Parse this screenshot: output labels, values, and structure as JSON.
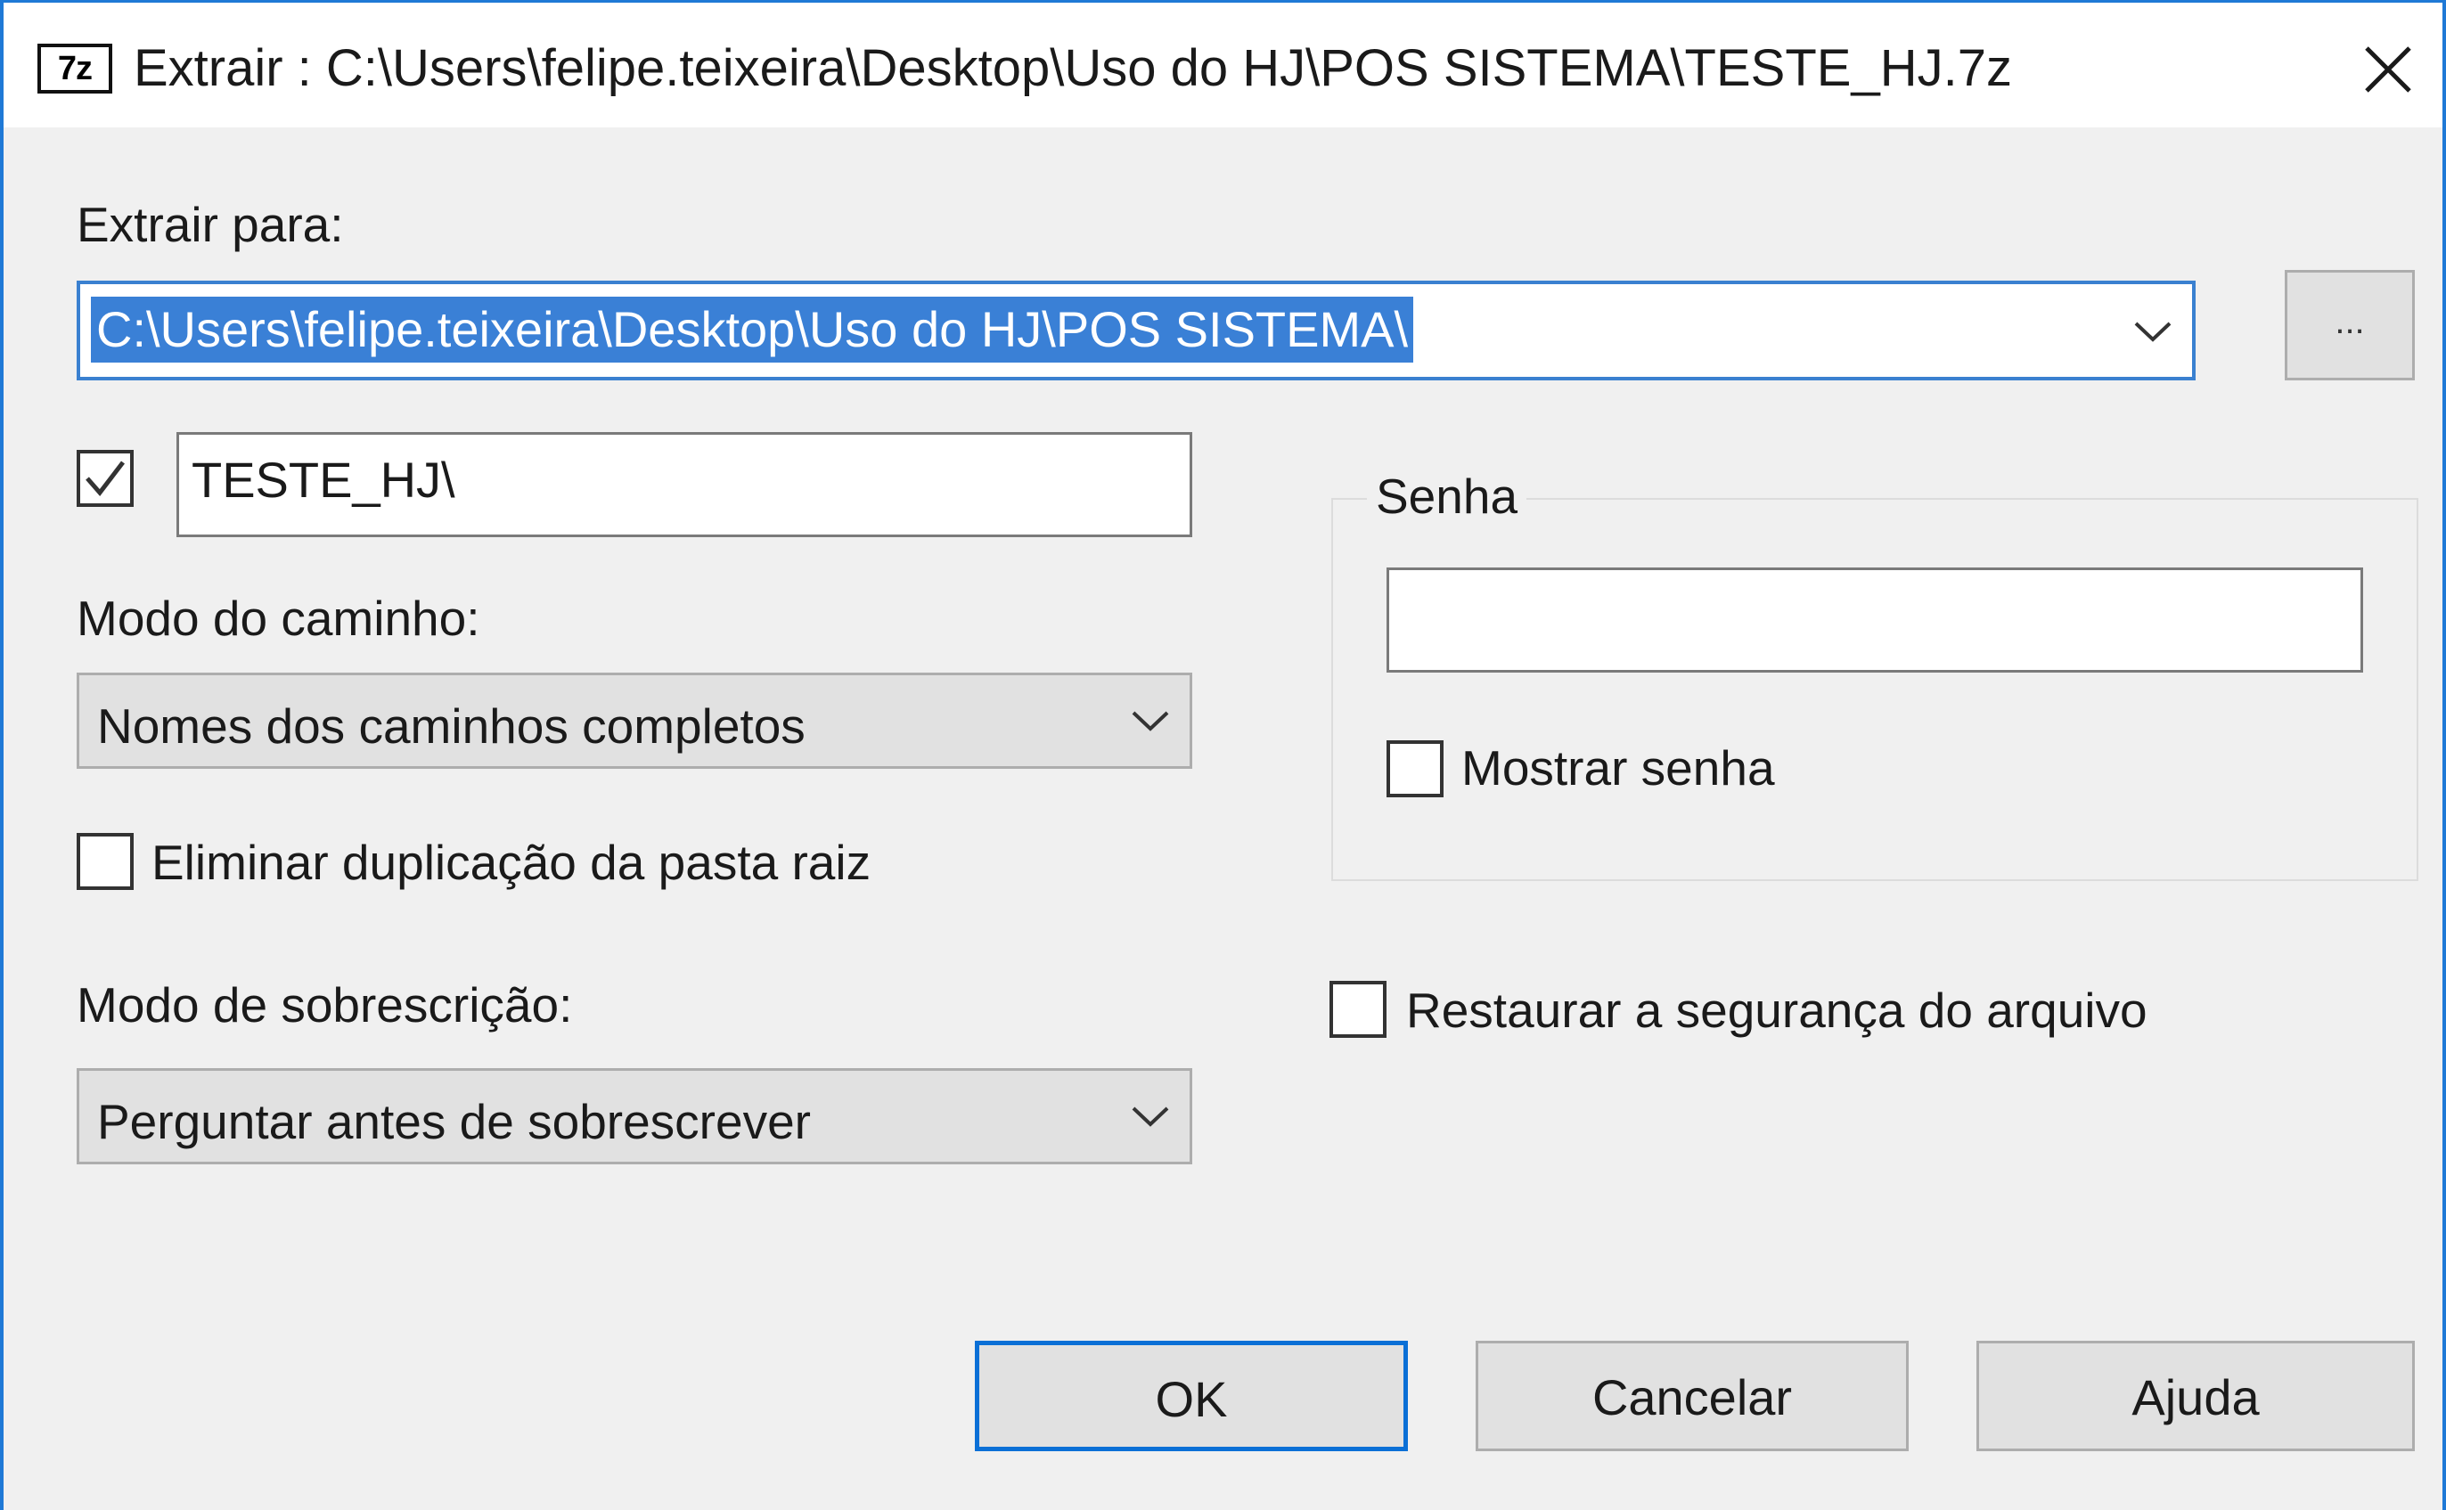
{
  "window": {
    "title": "Extrair : C:\\Users\\felipe.teixeira\\Desktop\\Uso do HJ\\POS SISTEMA\\TESTE_HJ.7z",
    "app_icon_text": "7z",
    "close_symbol": "close-icon"
  },
  "extract_to": {
    "label": "Extrair para:",
    "path_value": "C:\\Users\\felipe.teixeira\\Desktop\\Uso do HJ\\POS SISTEMA\\",
    "browse_label": "..."
  },
  "subfolder": {
    "checked": true,
    "value": "TESTE_HJ\\"
  },
  "path_mode": {
    "label": "Modo do caminho:",
    "selected": "Nomes dos caminhos completos"
  },
  "eliminate_duplication": {
    "label": "Eliminar duplicação da pasta raiz",
    "checked": false
  },
  "overwrite_mode": {
    "label": "Modo de sobrescrição:",
    "selected": "Perguntar antes de sobrescrever"
  },
  "password_group": {
    "legend": "Senha",
    "value": "",
    "show_password_label": "Mostrar senha",
    "show_password_checked": false
  },
  "restore_security": {
    "label": "Restaurar a segurança do arquivo",
    "checked": false
  },
  "buttons": {
    "ok": "OK",
    "cancel": "Cancelar",
    "help": "Ajuda"
  },
  "colors": {
    "accent": "#1f79d6",
    "selection": "#3a80d6",
    "button_face": "#e1e1e1",
    "window_bg": "#f0f0f0"
  }
}
